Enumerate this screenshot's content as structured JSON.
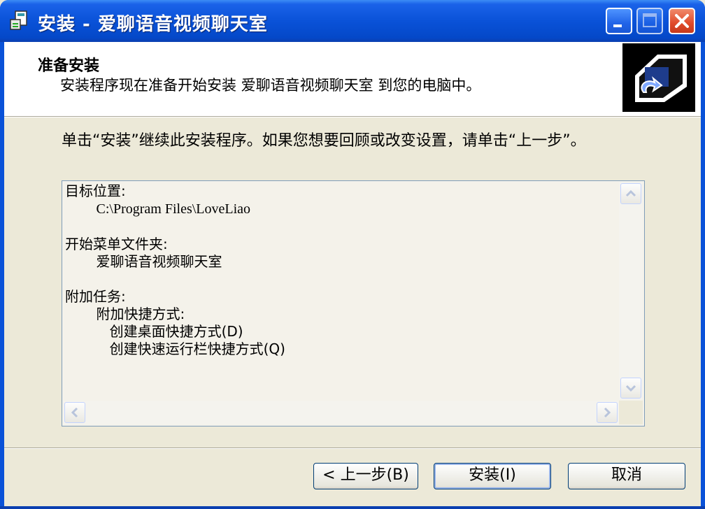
{
  "window": {
    "title": "安装 - 爱聊语音视频聊天室"
  },
  "header": {
    "title": "准备安装",
    "subtitle": "安装程序现在准备开始安装 爱聊语音视频聊天室 到您的电脑中。"
  },
  "body": {
    "intro": "单击“安装”继续此安装程序。如果您想要回顾或改变设置，请单击“上一步”。"
  },
  "memo": {
    "dest_label": "目标位置:",
    "dest_value": "C:\\Program Files\\LoveLiao",
    "menu_label": "开始菜单文件夹:",
    "menu_value": "爱聊语音视频聊天室",
    "tasks_label": "附加任务:",
    "tasks_group": "附加快捷方式:",
    "task_1": "创建桌面快捷方式(D)",
    "task_2": "创建快速运行栏快捷方式(Q)"
  },
  "buttons": {
    "back": "< 上一步(B)",
    "install": "安装(I)",
    "cancel": "取消"
  },
  "colors": {
    "titlebar": "#0a52d8",
    "dialog_bg": "#ece9d8",
    "close_button": "#e04a2a"
  },
  "icons": {
    "app": "installer-icon",
    "header": "computer-install-icon"
  }
}
